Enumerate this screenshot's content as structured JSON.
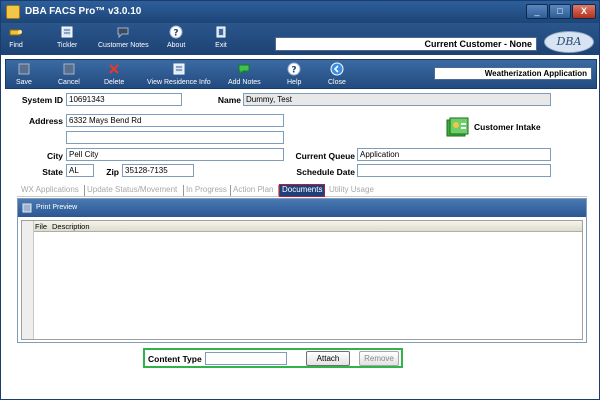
{
  "window": {
    "title": "DBA FACS Pro™ v3.0.10",
    "controls": {
      "minimize": "_",
      "maximize": "□",
      "close": "X"
    }
  },
  "main_toolbar": {
    "buttons": [
      {
        "label": "Find",
        "icon": "find-icon"
      },
      {
        "label": "Tickler",
        "icon": "tickler-icon"
      },
      {
        "label": "Customer Notes",
        "icon": "customer-notes-icon"
      },
      {
        "label": "About",
        "icon": "about-icon"
      },
      {
        "label": "Exit",
        "icon": "exit-icon"
      }
    ],
    "current_customer": "Current Customer - None",
    "logo": "DBA"
  },
  "sub_toolbar": {
    "buttons": [
      {
        "label": "Save",
        "icon": "save-icon"
      },
      {
        "label": "Cancel",
        "icon": "cancel-icon"
      },
      {
        "label": "Delete",
        "icon": "delete-icon"
      },
      {
        "label": "View Residence Info",
        "icon": "residence-info-icon"
      },
      {
        "label": "Add Notes",
        "icon": "add-notes-icon"
      },
      {
        "label": "Help",
        "icon": "help-icon"
      },
      {
        "label": "Close",
        "icon": "close-icon"
      }
    ],
    "section_title": "Weatherization Application"
  },
  "form": {
    "system_id": {
      "label": "System ID",
      "value": "10691343"
    },
    "name": {
      "label": "Name",
      "value": "Dummy, Test"
    },
    "address": {
      "label": "Address",
      "line1": "6332 Mays Bend Rd",
      "line2": ""
    },
    "city": {
      "label": "City",
      "value": "Pell City"
    },
    "state": {
      "label": "State",
      "value": "AL"
    },
    "zip": {
      "label": "Zip",
      "value": "35128-7135"
    },
    "current_queue": {
      "label": "Current Queue",
      "value": "Application"
    },
    "schedule_date": {
      "label": "Schedule Date",
      "value": ""
    },
    "customer_intake": "Customer Intake"
  },
  "tabs": [
    {
      "label": "WX Applications",
      "active": false
    },
    {
      "label": "Update Status/Movement",
      "active": false
    },
    {
      "label": "In Progress",
      "active": false
    },
    {
      "label": "Action Plan",
      "active": false
    },
    {
      "label": "Documents",
      "active": true
    },
    {
      "label": "Utility Usage",
      "active": false
    }
  ],
  "documents": {
    "print_preview": "Print Preview",
    "columns": [
      "File",
      "Description"
    ],
    "rows": []
  },
  "bottom": {
    "content_type_label": "Content Type",
    "content_type_value": "",
    "attach": "Attach",
    "remove": "Remove"
  },
  "colors": {
    "titlebar": "#2d5f9c",
    "toolbar": "#1d4274",
    "active_tab": "#1f3f7a",
    "active_tab_border": "#b0203a",
    "bottom_border": "#2fb34a"
  }
}
